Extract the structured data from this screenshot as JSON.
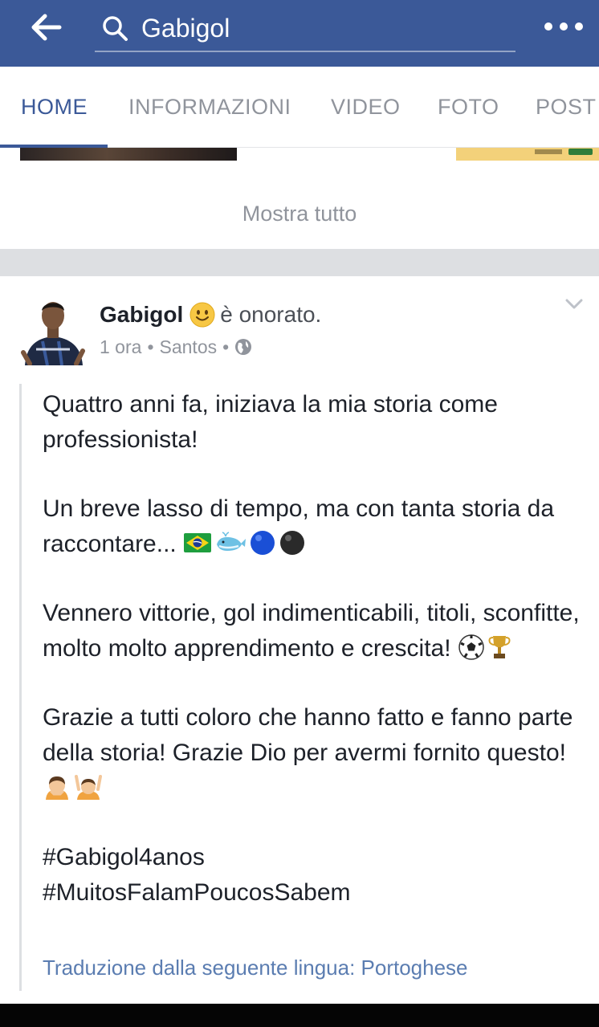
{
  "header": {
    "back_icon": "arrow-left-icon",
    "search_icon": "search-icon",
    "search_value": "Gabigol",
    "more_icon": "more-horizontal-icon",
    "background_color": "#3b5998"
  },
  "tabs": [
    {
      "label": "HOME",
      "active": true
    },
    {
      "label": "INFORMAZIONI",
      "active": false
    },
    {
      "label": "VIDEO",
      "active": false
    },
    {
      "label": "FOTO",
      "active": false
    },
    {
      "label": "POST",
      "active": false
    }
  ],
  "photos_section": {
    "show_all_label": "Mostra tutto"
  },
  "post": {
    "author": "Gabigol",
    "feeling_icon": "smiley-face-icon",
    "feeling_text": "è onorato.",
    "time": "1 ora",
    "separator": "•",
    "location": "Santos",
    "privacy_icon": "globe-icon",
    "options_icon": "chevron-down-icon",
    "paragraphs": {
      "p1": "Quattro anni fa, iniziava la mia storia come professionista!",
      "p2": "Un breve lasso di tempo, ma con tanta storia da raccontare...",
      "p3": "Vennero vittorie, gol indimenticabili, titoli, sconfitte, molto molto apprendimento e crescita!",
      "p4": "Grazie a tutti coloro che hanno fatto e fanno parte della storia! Grazie Dio per avermi fornito questo!"
    },
    "p2_emojis": [
      "brazil-flag-icon",
      "whale-icon",
      "blue-ball-icon",
      "black-ball-icon"
    ],
    "p3_emojis": [
      "soccer-ball-icon",
      "trophy-icon"
    ],
    "p4_emojis": [
      "person-bowing-icon",
      "person-raising-hands-icon"
    ],
    "hashtags": [
      "#Gabigol4anos",
      "#MuitosFalamPoucosSabem"
    ],
    "translation_note": "Traduzione dalla seguente lingua: Portoghese"
  },
  "colors": {
    "accent": "#3b5998",
    "link": "#5b7db1",
    "muted": "#90949c",
    "text": "#1d2129"
  }
}
